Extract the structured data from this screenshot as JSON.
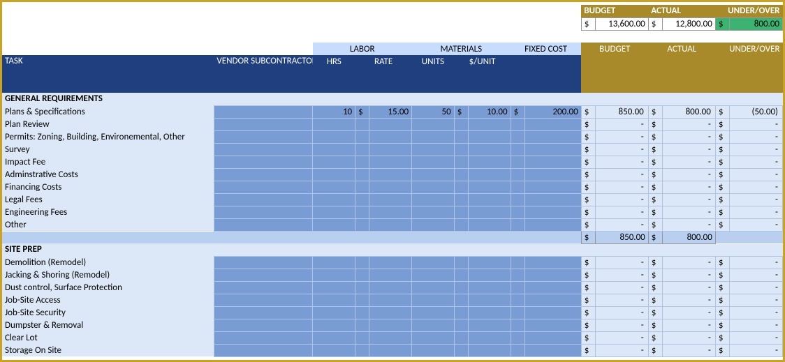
{
  "summary": {
    "labels": {
      "budget": "BUDGET",
      "actual": "ACTUAL",
      "under_over": "UNDER/OVER"
    },
    "values": {
      "budget": "13,600.00",
      "actual": "12,800.00",
      "under_over": "800.00"
    }
  },
  "group_headers": {
    "labor": "LABOR",
    "materials": "MATERIALS",
    "fixed": "FIXED COST"
  },
  "col_headers": {
    "task": "TASK",
    "vendor": "VENDOR SUBCONTRACTOR / CONTRACTOR",
    "hrs": "HRS",
    "rate": "RATE",
    "units": "UNITS",
    "per_unit": "$/UNIT",
    "budget": "BUDGET",
    "actual": "ACTUAL",
    "under_over": "UNDER/OVER"
  },
  "dash": "-",
  "dollar": "$",
  "sections": [
    {
      "title": "GENERAL REQUIREMENTS",
      "rows": [
        {
          "task": "Plans & Specifications",
          "hrs": "10",
          "rate": "15.00",
          "units": "50",
          "per_unit": "10.00",
          "fixed": "200.00",
          "budget": "850.00",
          "actual": "800.00",
          "under_over": "(50.00)"
        },
        {
          "task": "Plan Review"
        },
        {
          "task": "Permits: Zoning, Building, Environemental, Other"
        },
        {
          "task": "Survey"
        },
        {
          "task": "Impact Fee"
        },
        {
          "task": "Adminstrative Costs"
        },
        {
          "task": "Financing Costs"
        },
        {
          "task": "Legal Fees"
        },
        {
          "task": "Engineering Fees"
        },
        {
          "task": "Other"
        }
      ],
      "subtotal": {
        "budget": "850.00",
        "actual": "800.00"
      }
    },
    {
      "title": "SITE PREP",
      "rows": [
        {
          "task": "Demolition (Remodel)"
        },
        {
          "task": "Jacking & Shoring (Remodel)"
        },
        {
          "task": "Dust control, Surface Protection"
        },
        {
          "task": "Job-Site Access"
        },
        {
          "task": "Job-Site Security"
        },
        {
          "task": "Dumpster & Removal"
        },
        {
          "task": "Clear Lot"
        },
        {
          "task": "Storage On Site"
        }
      ]
    }
  ]
}
